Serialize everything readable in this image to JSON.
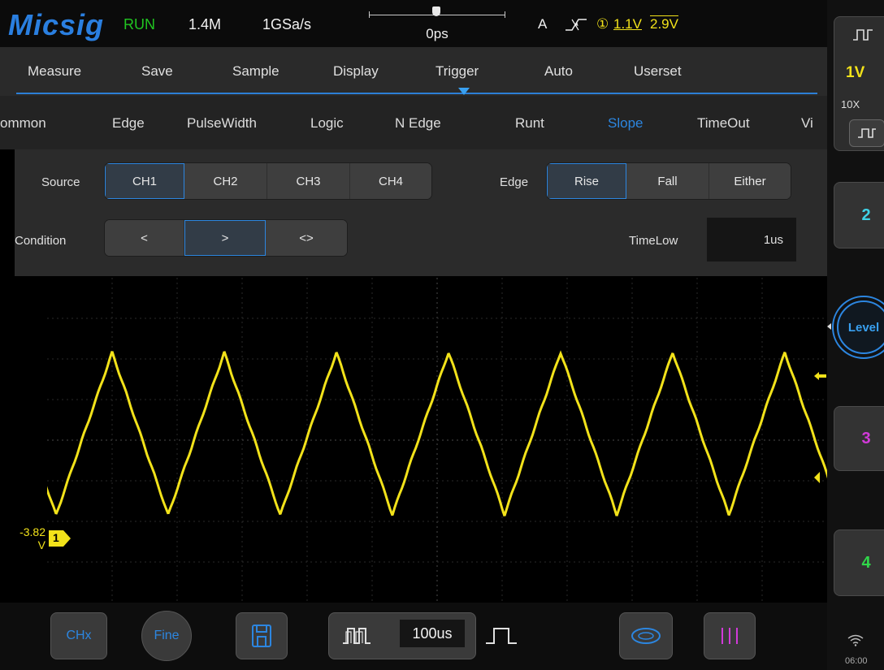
{
  "status": {
    "logo": "Micsig",
    "run_state": "RUN",
    "memory_depth": "1.4M",
    "sample_rate": "1GSa/s",
    "trigger_position": "0ps",
    "trigger_source": "A",
    "trigger_icon": "slope-trigger-icon",
    "trigger_channel_mark": "①",
    "trigger_level_low": "1.1V",
    "trigger_level_high": "2.9V"
  },
  "menu_tabs": [
    "Measure",
    "Save",
    "Sample",
    "Display",
    "Trigger",
    "Auto",
    "Userset"
  ],
  "active_menu_tab": "Trigger",
  "trigger_types": [
    "ommon",
    "Edge",
    "PulseWidth",
    "Logic",
    "N Edge",
    "Runt",
    "Slope",
    "TimeOut",
    "Vi"
  ],
  "active_trigger_type": "Slope",
  "settings": {
    "source_label": "Source",
    "source_options": [
      "CH1",
      "CH2",
      "CH3",
      "CH4"
    ],
    "source_selected": "CH1",
    "edge_label": "Edge",
    "edge_options": [
      "Rise",
      "Fall",
      "Either"
    ],
    "edge_selected": "Rise",
    "condition_label": "Condition",
    "condition_options": [
      "<",
      ">",
      "<>"
    ],
    "condition_selected": ">",
    "timelow_label": "TimeLow",
    "timelow_value": "1us"
  },
  "screen": {
    "channel_marker": "1",
    "offset_value": "-3.82",
    "offset_unit": "V",
    "waveform_color": "#f2e21a",
    "waveform_type": "triangle",
    "cycles_visible": 7
  },
  "bottom": {
    "chx_label": "CHx",
    "fine_label": "Fine",
    "save_icon": "save-icon",
    "timebase_value": "100us",
    "zoom_icon": "zoom-icon",
    "cursor_icon": "cursor-icon"
  },
  "side": {
    "ch1_volts": "1V",
    "ch1_probe": "10X",
    "ch2_label": "2",
    "level_label": "Level",
    "ch3_label": "3",
    "ch4_label": "4",
    "time": "06:00"
  },
  "colors": {
    "ch1": "#f2e21a",
    "ch2": "#3fd2e6",
    "ch3": "#d23ad9",
    "ch4": "#30d84a",
    "accent": "#2c86e0",
    "run": "#21c521"
  }
}
